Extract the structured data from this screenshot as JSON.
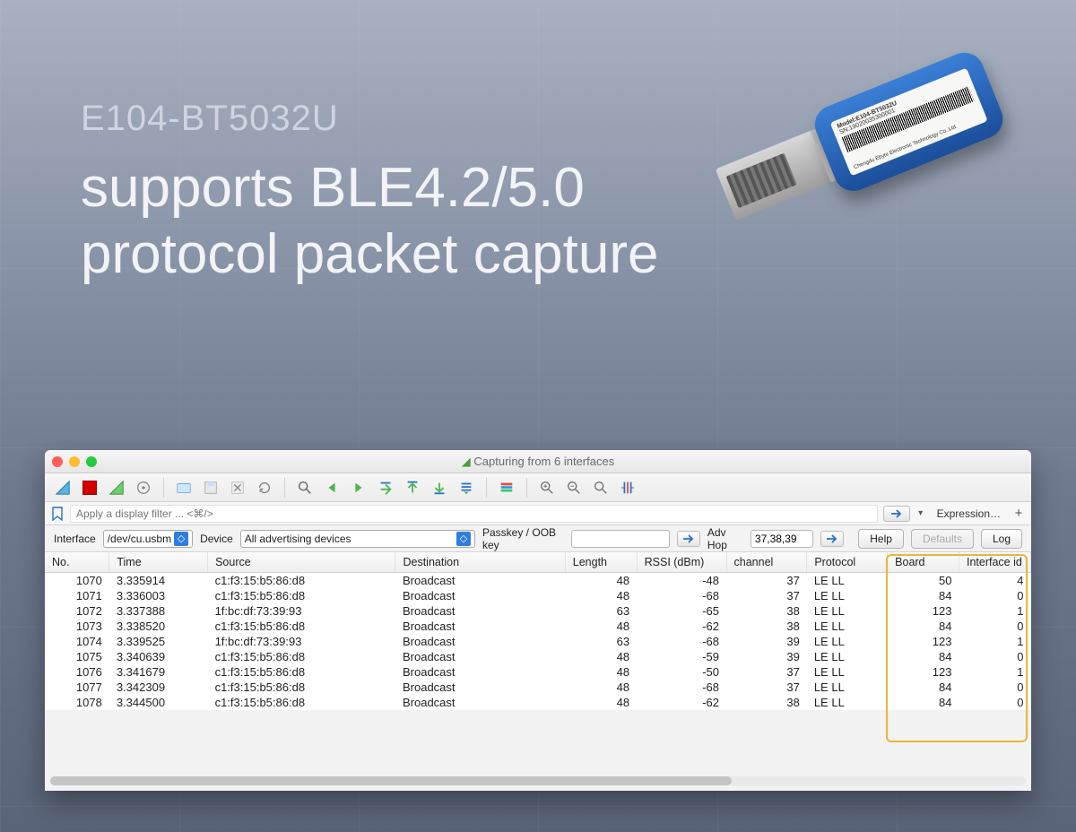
{
  "hero": {
    "model": "E104-BT5032U",
    "line1": "supports BLE4.2/5.0",
    "line2": "protocol packet capture"
  },
  "dongle": {
    "model_label": "Model:E104-BT5032U",
    "sn_label": "SN:19020035300001",
    "company": "Chengdu Ebyte Electronic Technology Co.,Ltd."
  },
  "window": {
    "title_prefix": "Capturing from 6 interfaces",
    "filter_placeholder": "Apply a display filter ... <⌘/>",
    "expression_btn": "Expression…",
    "params": {
      "interface_label": "Interface",
      "interface_value": "/dev/cu.usbm",
      "device_label": "Device",
      "device_value": "All advertising devices",
      "passkey_label": "Passkey / OOB key",
      "passkey_value": "",
      "advhop_label": "Adv Hop",
      "advhop_value": "37,38,39",
      "help_btn": "Help",
      "defaults_btn": "Defaults",
      "log_btn": "Log"
    },
    "columns": [
      "No.",
      "Time",
      "Source",
      "Destination",
      "Length",
      "RSSI (dBm)",
      "channel",
      "Protocol",
      "Board",
      "Interface id"
    ],
    "rows": [
      {
        "no": "1070",
        "time": "3.335914",
        "src": "c1:f3:15:b5:86:d8",
        "dst": "Broadcast",
        "len": "48",
        "rssi": "-48",
        "ch": "37",
        "proto": "LE LL",
        "board": "50",
        "ifid": "4"
      },
      {
        "no": "1071",
        "time": "3.336003",
        "src": "c1:f3:15:b5:86:d8",
        "dst": "Broadcast",
        "len": "48",
        "rssi": "-68",
        "ch": "37",
        "proto": "LE LL",
        "board": "84",
        "ifid": "0"
      },
      {
        "no": "1072",
        "time": "3.337388",
        "src": "1f:bc:df:73:39:93",
        "dst": "Broadcast",
        "len": "63",
        "rssi": "-65",
        "ch": "38",
        "proto": "LE LL",
        "board": "123",
        "ifid": "1"
      },
      {
        "no": "1073",
        "time": "3.338520",
        "src": "c1:f3:15:b5:86:d8",
        "dst": "Broadcast",
        "len": "48",
        "rssi": "-62",
        "ch": "38",
        "proto": "LE LL",
        "board": "84",
        "ifid": "0"
      },
      {
        "no": "1074",
        "time": "3.339525",
        "src": "1f:bc:df:73:39:93",
        "dst": "Broadcast",
        "len": "63",
        "rssi": "-68",
        "ch": "39",
        "proto": "LE LL",
        "board": "123",
        "ifid": "1"
      },
      {
        "no": "1075",
        "time": "3.340639",
        "src": "c1:f3:15:b5:86:d8",
        "dst": "Broadcast",
        "len": "48",
        "rssi": "-59",
        "ch": "39",
        "proto": "LE LL",
        "board": "84",
        "ifid": "0"
      },
      {
        "no": "1076",
        "time": "3.341679",
        "src": "c1:f3:15:b5:86:d8",
        "dst": "Broadcast",
        "len": "48",
        "rssi": "-50",
        "ch": "37",
        "proto": "LE LL",
        "board": "123",
        "ifid": "1"
      },
      {
        "no": "1077",
        "time": "3.342309",
        "src": "c1:f3:15:b5:86:d8",
        "dst": "Broadcast",
        "len": "48",
        "rssi": "-68",
        "ch": "37",
        "proto": "LE LL",
        "board": "84",
        "ifid": "0"
      },
      {
        "no": "1078",
        "time": "3.344500",
        "src": "c1:f3:15:b5:86:d8",
        "dst": "Broadcast",
        "len": "48",
        "rssi": "-62",
        "ch": "38",
        "proto": "LE LL",
        "board": "84",
        "ifid": "0"
      }
    ]
  }
}
